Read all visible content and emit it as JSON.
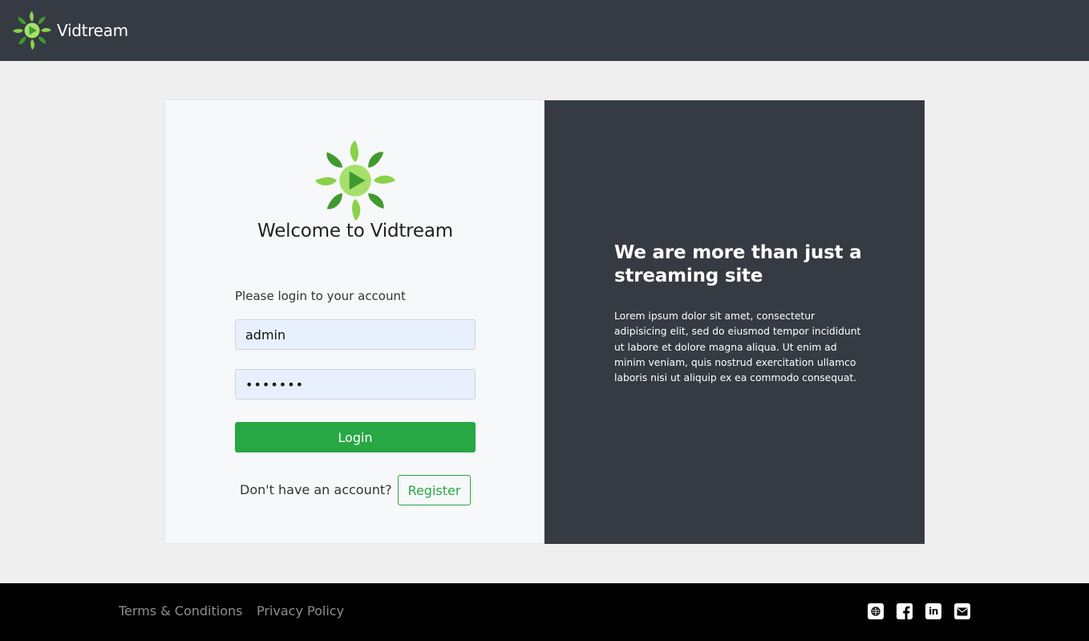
{
  "header": {
    "brand_name": "Vidtream"
  },
  "login": {
    "welcome_title": "Welcome to Vidtream",
    "prompt": "Please login to your account",
    "username_value": "admin",
    "password_value": "•••••••",
    "login_label": "Login",
    "no_account_text": "Don't have an account?",
    "register_label": "Register"
  },
  "promo": {
    "heading": "We are more than just a streaming site",
    "body": "Lorem ipsum dolor sit amet, consectetur adipisicing elit, sed do eiusmod tempor incididunt ut labore et dolore magna aliqua. Ut enim ad minim veniam, quis nostrud exercitation ullamco laboris nisi ut aliquip ex ea commodo consequat."
  },
  "footer": {
    "links": [
      "Terms & Conditions",
      "Privacy Policy"
    ],
    "social": [
      "globe-icon",
      "facebook-icon",
      "linkedin-icon",
      "mail-icon"
    ]
  },
  "colors": {
    "dark_bg": "#363a42",
    "accent_green": "#28a745",
    "page_bg": "#efefef",
    "logo_light_green": "#8ad24a",
    "logo_dark_green": "#3f9a2e"
  }
}
